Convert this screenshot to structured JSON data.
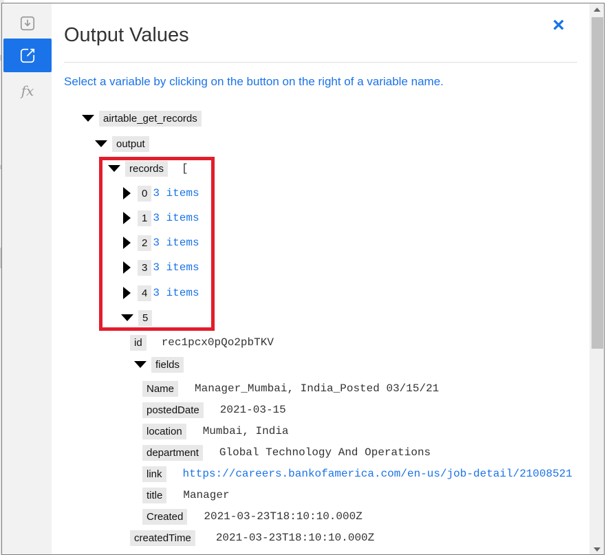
{
  "modal": {
    "title": "Output Values",
    "close_icon": "×",
    "hint": "Select a variable by clicking on the button on the right of a variable name."
  },
  "rail": {
    "items": [
      {
        "icon": "import-icon",
        "active": false
      },
      {
        "icon": "export-icon",
        "active": true
      },
      {
        "icon": "function-icon",
        "label": "fx",
        "active": false
      }
    ]
  },
  "tree": {
    "root_key": "airtable_get_records",
    "output_key": "output",
    "records_key": "records",
    "records_bracket": "[",
    "collapsed_items": [
      {
        "index": "0",
        "summary": "3 items"
      },
      {
        "index": "1",
        "summary": "3 items"
      },
      {
        "index": "2",
        "summary": "3 items"
      },
      {
        "index": "3",
        "summary": "3 items"
      },
      {
        "index": "4",
        "summary": "3 items"
      }
    ],
    "expanded_index": "5",
    "id": {
      "key": "id",
      "value": "rec1pcx0pQo2pbTKV"
    },
    "fields_key": "fields",
    "fields": [
      {
        "key": "Name",
        "value": "Manager_Mumbai, India_Posted 03/15/21"
      },
      {
        "key": "postedDate",
        "value": "2021-03-15"
      },
      {
        "key": "location",
        "value": "Mumbai, India"
      },
      {
        "key": "department",
        "value": "Global Technology And Operations"
      },
      {
        "key": "link",
        "value": "https://careers.bankofamerica.com/en-us/job-detail/21008521"
      },
      {
        "key": "title",
        "value": "Manager"
      },
      {
        "key": "Created",
        "value": "2021-03-23T18:10:10.000Z"
      }
    ],
    "createdTime": {
      "key": "createdTime",
      "value": "2021-03-23T18:10:10.000Z"
    }
  },
  "colors": {
    "accent": "#1a73e8",
    "highlight": "#e31d2b"
  }
}
